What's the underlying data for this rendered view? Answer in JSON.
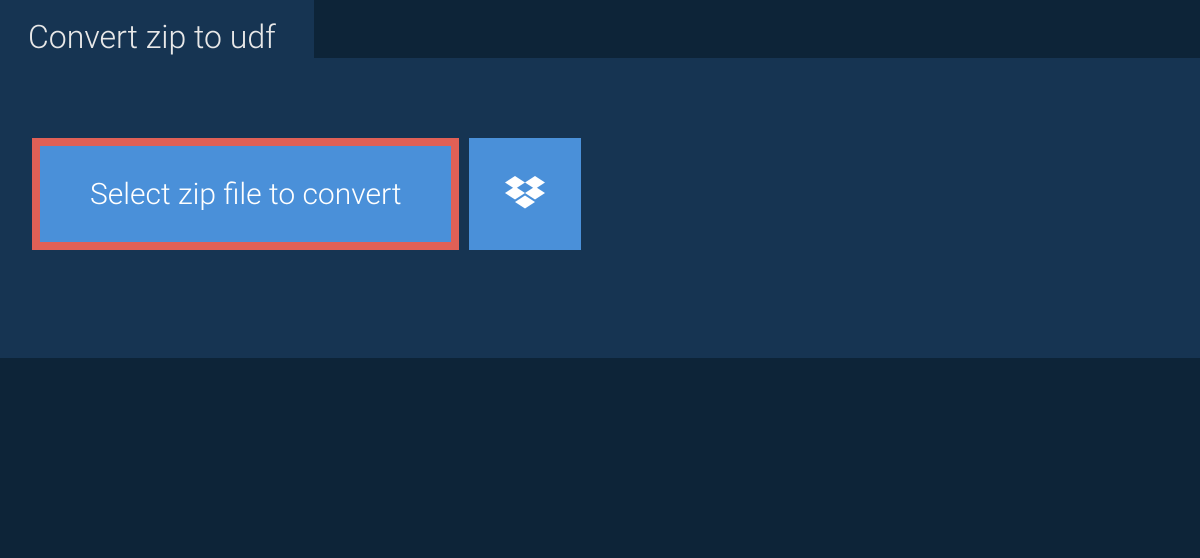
{
  "tab": {
    "title": "Convert zip to udf"
  },
  "buttons": {
    "select_label": "Select zip file to convert"
  },
  "colors": {
    "background": "#0d2438",
    "panel": "#163452",
    "button": "#4a90d9",
    "highlight_border": "#e06056",
    "text": "#ffffff"
  }
}
